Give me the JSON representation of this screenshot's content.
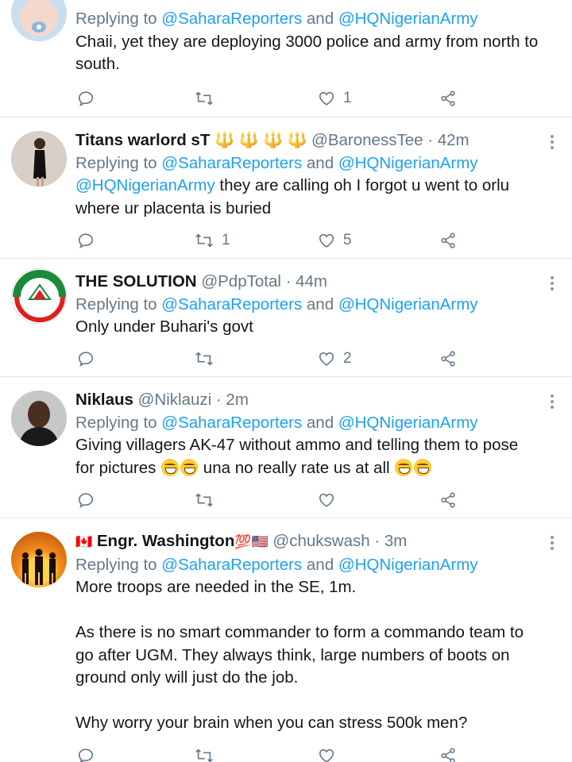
{
  "tweets": [
    {
      "reply_prefix": "Replying to ",
      "reply_to_1": "@SaharaReporters",
      "reply_and": " and ",
      "reply_to_2": "@HQNigerianArmy",
      "text": "Chaii, yet they are deploying 3000 police and army from north to south.",
      "replies": "",
      "retweets": "",
      "likes": "1"
    },
    {
      "name": "Titans warlord sT",
      "name_emoji": "🔱 🔱 🔱 🔱",
      "handle": "@BaronessTee",
      "time": " · 42m",
      "reply_prefix": "Replying to ",
      "reply_to_1": "@SaharaReporters",
      "reply_and": " and ",
      "reply_to_2": "@HQNigerianArmy",
      "mention": "@HQNigerianArmy",
      "text": " they are calling oh I forgot u went to orlu\nwhere ur placenta is buried",
      "replies": "",
      "retweets": "1",
      "likes": "5"
    },
    {
      "name": "THE SOLUTION",
      "handle": "@PdpTotal",
      "time": " · 44m",
      "reply_prefix": "Replying to ",
      "reply_to_1": "@SaharaReporters",
      "reply_and": " and ",
      "reply_to_2": "@HQNigerianArmy",
      "text": "Only under Buhari's govt",
      "replies": "",
      "retweets": "",
      "likes": "2"
    },
    {
      "name": "Niklaus",
      "handle": "@Niklauzi",
      "time": " · 2m",
      "reply_prefix": "Replying to ",
      "reply_to_1": "@SaharaReporters",
      "reply_and": " and ",
      "reply_to_2": "@HQNigerianArmy",
      "text_line1": "Giving villagers AK-47 without ammo and telling them to pose",
      "text_line2a": "for pictures ",
      "text_line2b": " una no really rate us at all ",
      "replies": "",
      "retweets": "",
      "likes": ""
    },
    {
      "name": "Engr. Washington",
      "name_flag_prefix": "🇨🇦",
      "name_suffix": "💯🇺🇸",
      "handle": "@chukswash",
      "time": " · 3m",
      "reply_prefix": "Replying to ",
      "reply_to_1": "@SaharaReporters",
      "reply_and": " and ",
      "reply_to_2": "@HQNigerianArmy",
      "text": "More troops are needed in the SE, 1m.\n\nAs there is no smart commander to form a commando team to\ngo after UGM. They always think, large numbers of boots on\nground only will just do the job.\n\nWhy worry your brain when you can stress 500k men?"
    }
  ],
  "colors": {
    "link": "#1da1f2",
    "muted": "#657786",
    "divider": "#e1e8ed",
    "text": "#14171a"
  },
  "icons": [
    "reply-icon",
    "retweet-icon",
    "like-icon",
    "share-icon",
    "more-icon"
  ]
}
